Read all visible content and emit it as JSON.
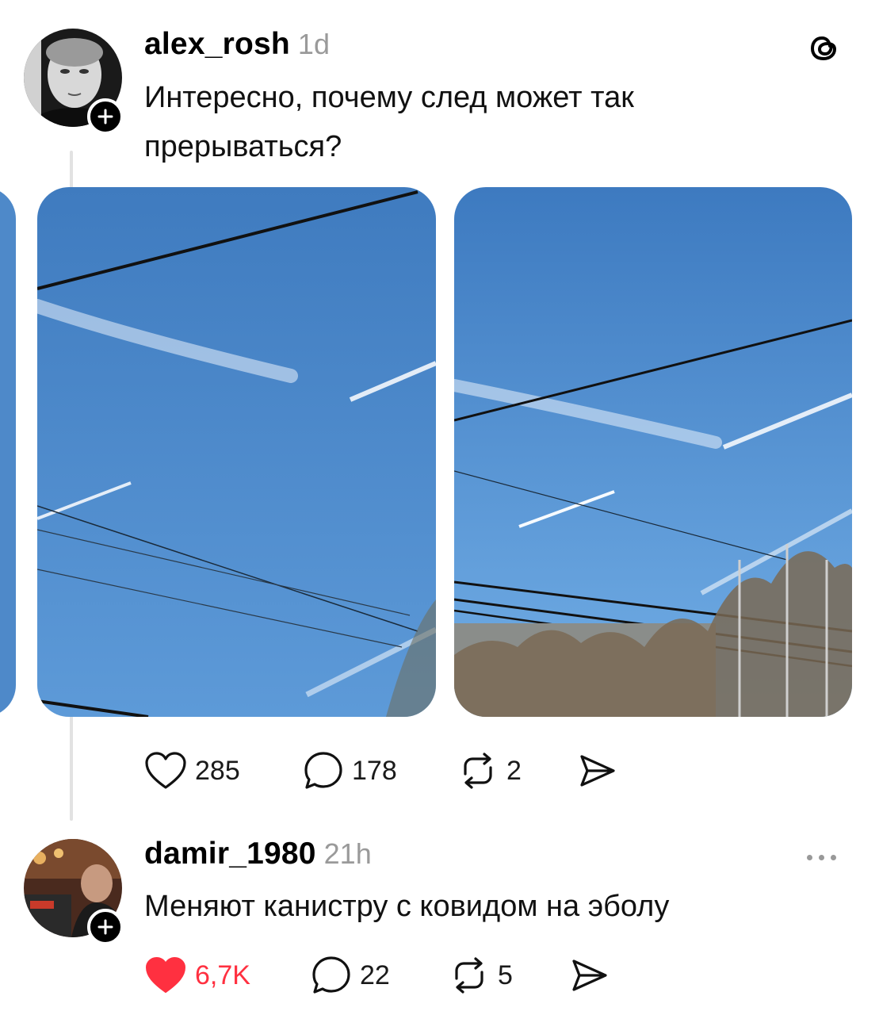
{
  "post": {
    "username": "alex_rosh",
    "time": "1d",
    "text_line1": "Интересно, почему след может так",
    "text_line2": "прерываться?",
    "likes": "285",
    "comments": "178",
    "reposts": "2"
  },
  "reply": {
    "username": "damir_1980",
    "time": "21h",
    "text": "Меняют канистру с ковидом на эболу",
    "likes": "6,7K",
    "comments": "22",
    "reposts": "5",
    "liked": true
  },
  "icons": {
    "app_logo": "threads-logo-icon",
    "follow": "plus-icon",
    "like": "heart-icon",
    "comment": "comment-bubble-icon",
    "repost": "repost-icon",
    "share": "send-icon",
    "more": "more-dots-icon"
  },
  "colors": {
    "liked_heart": "#ff3040",
    "muted": "#9a9a9a",
    "sky": "#4a86c8"
  }
}
